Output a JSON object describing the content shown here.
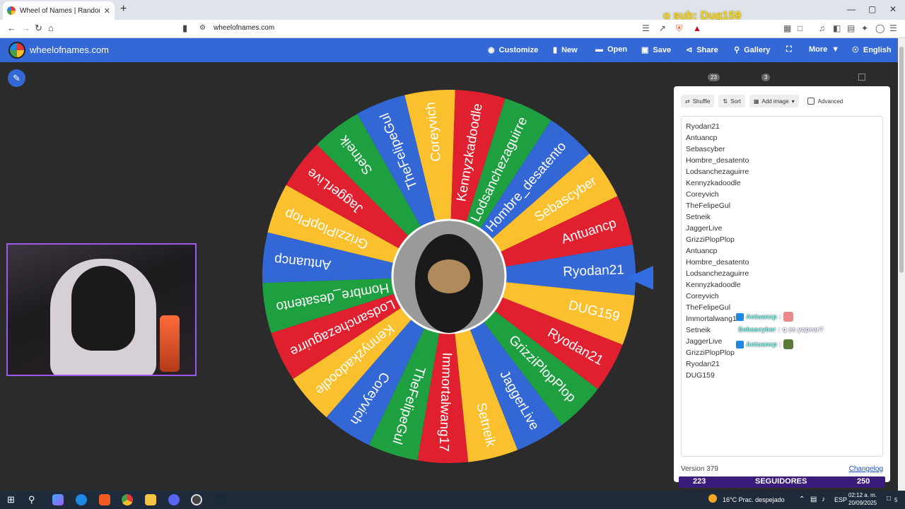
{
  "browser": {
    "tab_title": "Wheel of Names | Random name",
    "tab_close": "✕",
    "new_tab": "+",
    "url": "wheelofnames.com",
    "window_controls": [
      "—",
      "▢",
      "✕"
    ]
  },
  "overlay": {
    "sub_alert": "o sub: Dug159"
  },
  "site": {
    "name": "wheelofnames.com",
    "menu": {
      "customize": "Customize",
      "new": "New",
      "open": "Open",
      "save": "Save",
      "share": "Share",
      "gallery": "Gallery",
      "more": "More",
      "language": "English"
    }
  },
  "wheel": {
    "colors": [
      "#3367d6",
      "#fbc02d",
      "#e0202f",
      "#1fa040"
    ],
    "segments": [
      "Ryodan21",
      "DUG159",
      "Ryodan21",
      "GrizziPlopPlop",
      "JaggerLive",
      "Setneik",
      "Immortalwang17",
      "TheFelipeGul",
      "Coreyvich",
      "Kennyzkadoodle",
      "Lodsanchezaguirre",
      "Hombre_desatento",
      "Antuancp",
      "GrizziPlopPlop",
      "JaggerLive",
      "Setneik",
      "TheFelipeGul",
      "Coreyvich",
      "Kennyzkadoodle",
      "Lodsanchezaguirre",
      "Hombre_desatento",
      "Sebascyber",
      "Antuancp"
    ]
  },
  "panel": {
    "count_entries": "23",
    "count_results": "3",
    "shuffle": "Shuffle",
    "sort": "Sort",
    "add_image": "Add image",
    "advanced": "Advanced",
    "entries": [
      "Ryodan21",
      "Antuancp",
      "Sebascyber",
      "Hombre_desatento",
      "Lodsanchezaguirre",
      "Kennyzkadoodle",
      "Coreyvich",
      "TheFelipeGul",
      "Setneik",
      "JaggerLive",
      "GrizziPlopPlop",
      "Antuancp",
      "Hombre_desatento",
      "Lodsanchezaguirre",
      "Kennyzkadoodle",
      "Coreyvich",
      "TheFelipeGul",
      "Immortalwang17",
      "Setneik",
      "JaggerLive",
      "GrizziPlopPlop",
      "Ryodan21",
      "DUG159"
    ],
    "version": "Version 379",
    "changelog": "Changelog"
  },
  "chat": [
    {
      "user": "Antuancp",
      "sep": ":",
      "text": ""
    },
    {
      "user": "Sebascyber",
      "sep": ":",
      "text": "q es yapear?"
    },
    {
      "user": "Antuancp",
      "sep": ":",
      "text": ""
    }
  ],
  "follow_bar": {
    "current": "223",
    "label": "SEGUIDORES",
    "goal": "250"
  },
  "taskbar": {
    "weather": "16°C  Prac. despejado",
    "lang": "ESP",
    "time": "02:12 a. m.",
    "date": "20/09/2025",
    "notif": "5"
  }
}
